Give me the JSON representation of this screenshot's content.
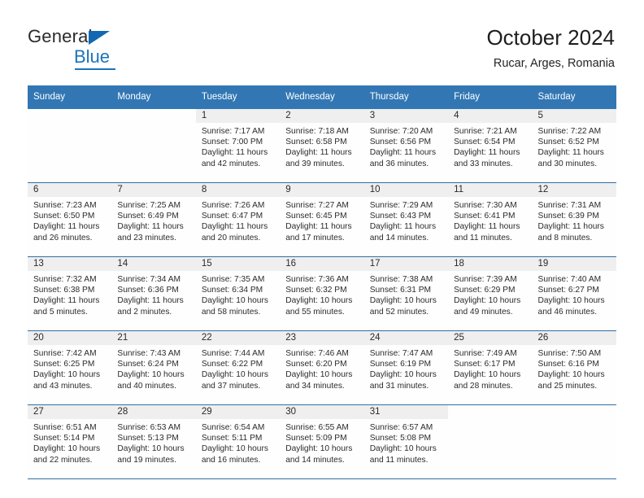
{
  "brand": {
    "name_part1": "General",
    "name_part2": "Blue",
    "triangle_color": "#1268b3",
    "blue_color": "#1b74bb"
  },
  "header": {
    "title": "October 2024",
    "subtitle": "Rucar, Arges, Romania"
  },
  "theme": {
    "header_bar": "#3277b3",
    "row_divider": "#2f6ea5",
    "daynum_strip": "#efefef",
    "cell_background": "#fefefe",
    "text": "#2b2b2b"
  },
  "calendar": {
    "weekday_headers": [
      "Sunday",
      "Monday",
      "Tuesday",
      "Wednesday",
      "Thursday",
      "Friday",
      "Saturday"
    ],
    "weeks": [
      [
        {
          "day": "",
          "lines": []
        },
        {
          "day": "",
          "lines": []
        },
        {
          "day": "1",
          "lines": [
            "Sunrise: 7:17 AM",
            "Sunset: 7:00 PM",
            "Daylight: 11 hours and 42 minutes."
          ]
        },
        {
          "day": "2",
          "lines": [
            "Sunrise: 7:18 AM",
            "Sunset: 6:58 PM",
            "Daylight: 11 hours and 39 minutes."
          ]
        },
        {
          "day": "3",
          "lines": [
            "Sunrise: 7:20 AM",
            "Sunset: 6:56 PM",
            "Daylight: 11 hours and 36 minutes."
          ]
        },
        {
          "day": "4",
          "lines": [
            "Sunrise: 7:21 AM",
            "Sunset: 6:54 PM",
            "Daylight: 11 hours and 33 minutes."
          ]
        },
        {
          "day": "5",
          "lines": [
            "Sunrise: 7:22 AM",
            "Sunset: 6:52 PM",
            "Daylight: 11 hours and 30 minutes."
          ]
        }
      ],
      [
        {
          "day": "6",
          "lines": [
            "Sunrise: 7:23 AM",
            "Sunset: 6:50 PM",
            "Daylight: 11 hours and 26 minutes."
          ]
        },
        {
          "day": "7",
          "lines": [
            "Sunrise: 7:25 AM",
            "Sunset: 6:49 PM",
            "Daylight: 11 hours and 23 minutes."
          ]
        },
        {
          "day": "8",
          "lines": [
            "Sunrise: 7:26 AM",
            "Sunset: 6:47 PM",
            "Daylight: 11 hours and 20 minutes."
          ]
        },
        {
          "day": "9",
          "lines": [
            "Sunrise: 7:27 AM",
            "Sunset: 6:45 PM",
            "Daylight: 11 hours and 17 minutes."
          ]
        },
        {
          "day": "10",
          "lines": [
            "Sunrise: 7:29 AM",
            "Sunset: 6:43 PM",
            "Daylight: 11 hours and 14 minutes."
          ]
        },
        {
          "day": "11",
          "lines": [
            "Sunrise: 7:30 AM",
            "Sunset: 6:41 PM",
            "Daylight: 11 hours and 11 minutes."
          ]
        },
        {
          "day": "12",
          "lines": [
            "Sunrise: 7:31 AM",
            "Sunset: 6:39 PM",
            "Daylight: 11 hours and 8 minutes."
          ]
        }
      ],
      [
        {
          "day": "13",
          "lines": [
            "Sunrise: 7:32 AM",
            "Sunset: 6:38 PM",
            "Daylight: 11 hours and 5 minutes."
          ]
        },
        {
          "day": "14",
          "lines": [
            "Sunrise: 7:34 AM",
            "Sunset: 6:36 PM",
            "Daylight: 11 hours and 2 minutes."
          ]
        },
        {
          "day": "15",
          "lines": [
            "Sunrise: 7:35 AM",
            "Sunset: 6:34 PM",
            "Daylight: 10 hours and 58 minutes."
          ]
        },
        {
          "day": "16",
          "lines": [
            "Sunrise: 7:36 AM",
            "Sunset: 6:32 PM",
            "Daylight: 10 hours and 55 minutes."
          ]
        },
        {
          "day": "17",
          "lines": [
            "Sunrise: 7:38 AM",
            "Sunset: 6:31 PM",
            "Daylight: 10 hours and 52 minutes."
          ]
        },
        {
          "day": "18",
          "lines": [
            "Sunrise: 7:39 AM",
            "Sunset: 6:29 PM",
            "Daylight: 10 hours and 49 minutes."
          ]
        },
        {
          "day": "19",
          "lines": [
            "Sunrise: 7:40 AM",
            "Sunset: 6:27 PM",
            "Daylight: 10 hours and 46 minutes."
          ]
        }
      ],
      [
        {
          "day": "20",
          "lines": [
            "Sunrise: 7:42 AM",
            "Sunset: 6:25 PM",
            "Daylight: 10 hours and 43 minutes."
          ]
        },
        {
          "day": "21",
          "lines": [
            "Sunrise: 7:43 AM",
            "Sunset: 6:24 PM",
            "Daylight: 10 hours and 40 minutes."
          ]
        },
        {
          "day": "22",
          "lines": [
            "Sunrise: 7:44 AM",
            "Sunset: 6:22 PM",
            "Daylight: 10 hours and 37 minutes."
          ]
        },
        {
          "day": "23",
          "lines": [
            "Sunrise: 7:46 AM",
            "Sunset: 6:20 PM",
            "Daylight: 10 hours and 34 minutes."
          ]
        },
        {
          "day": "24",
          "lines": [
            "Sunrise: 7:47 AM",
            "Sunset: 6:19 PM",
            "Daylight: 10 hours and 31 minutes."
          ]
        },
        {
          "day": "25",
          "lines": [
            "Sunrise: 7:49 AM",
            "Sunset: 6:17 PM",
            "Daylight: 10 hours and 28 minutes."
          ]
        },
        {
          "day": "26",
          "lines": [
            "Sunrise: 7:50 AM",
            "Sunset: 6:16 PM",
            "Daylight: 10 hours and 25 minutes."
          ]
        }
      ],
      [
        {
          "day": "27",
          "lines": [
            "Sunrise: 6:51 AM",
            "Sunset: 5:14 PM",
            "Daylight: 10 hours and 22 minutes."
          ]
        },
        {
          "day": "28",
          "lines": [
            "Sunrise: 6:53 AM",
            "Sunset: 5:13 PM",
            "Daylight: 10 hours and 19 minutes."
          ]
        },
        {
          "day": "29",
          "lines": [
            "Sunrise: 6:54 AM",
            "Sunset: 5:11 PM",
            "Daylight: 10 hours and 16 minutes."
          ]
        },
        {
          "day": "30",
          "lines": [
            "Sunrise: 6:55 AM",
            "Sunset: 5:09 PM",
            "Daylight: 10 hours and 14 minutes."
          ]
        },
        {
          "day": "31",
          "lines": [
            "Sunrise: 6:57 AM",
            "Sunset: 5:08 PM",
            "Daylight: 10 hours and 11 minutes."
          ]
        },
        {
          "day": "",
          "lines": []
        },
        {
          "day": "",
          "lines": []
        }
      ]
    ]
  }
}
